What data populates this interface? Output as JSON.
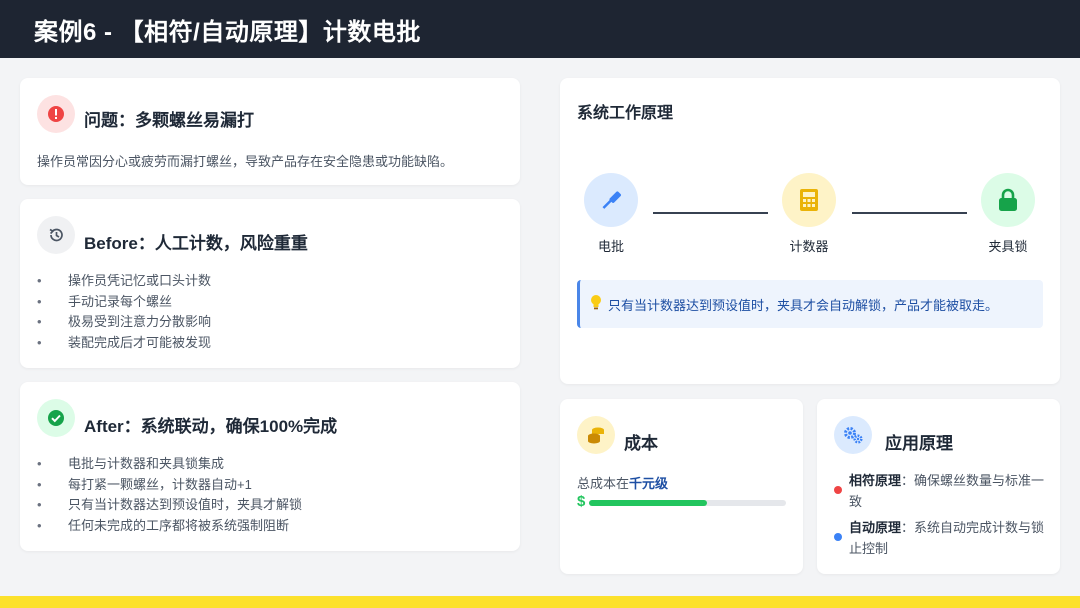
{
  "header": {
    "title": "案例6 - 【相符/自动原理】计数电批"
  },
  "problem": {
    "icon": "alert-icon",
    "title": "问题：多颗螺丝易漏打",
    "desc": "操作员常因分心或疲劳而漏打螺丝，导致产品存在安全隐患或功能缺陷。"
  },
  "before": {
    "icon": "history-icon",
    "title": "Before：人工计数，风险重重",
    "items": [
      "操作员凭记忆或口头计数",
      "手动记录每个螺丝",
      "极易受到注意力分散影响",
      "装配完成后才可能被发现"
    ]
  },
  "after": {
    "icon": "check-circle-icon",
    "title": "After：系统联动，确保100%完成",
    "items": [
      "电批与计数器和夹具锁集成",
      "每打紧一颗螺丝，计数器自动+1",
      "只有当计数器达到预设值时，夹具才解锁",
      "任何未完成的工序都将被系统强制阻断"
    ]
  },
  "system": {
    "title": "系统工作原理",
    "nodes": [
      {
        "label": "电批",
        "icon": "screwdriver-icon"
      },
      {
        "label": "计数器",
        "icon": "calculator-icon"
      },
      {
        "label": "夹具锁",
        "icon": "lock-icon"
      }
    ],
    "note": {
      "icon": "lightbulb-icon",
      "text": "只有当计数器达到预设值时，夹具才会自动解锁，产品才能被取走。"
    }
  },
  "cost": {
    "icon": "coins-icon",
    "title": "成本",
    "text_prefix": "总成本在",
    "text_highlight": "千元级",
    "currency_symbol": "$",
    "progress": 0.6
  },
  "principle": {
    "icon": "gears-icon",
    "title": "应用原理",
    "items": [
      {
        "name": "相符原理",
        "sep": "：",
        "desc": "确保螺丝数量与标准一致"
      },
      {
        "name": "自动原理",
        "sep": "：",
        "desc": "系统自动完成计数与锁止控制"
      }
    ]
  },
  "colors": {
    "header_bg": "#1e2532",
    "accent_yellow": "#fce12c",
    "success_green": "#22c55e",
    "alert_red": "#ef4444",
    "info_blue": "#3b82f6"
  }
}
